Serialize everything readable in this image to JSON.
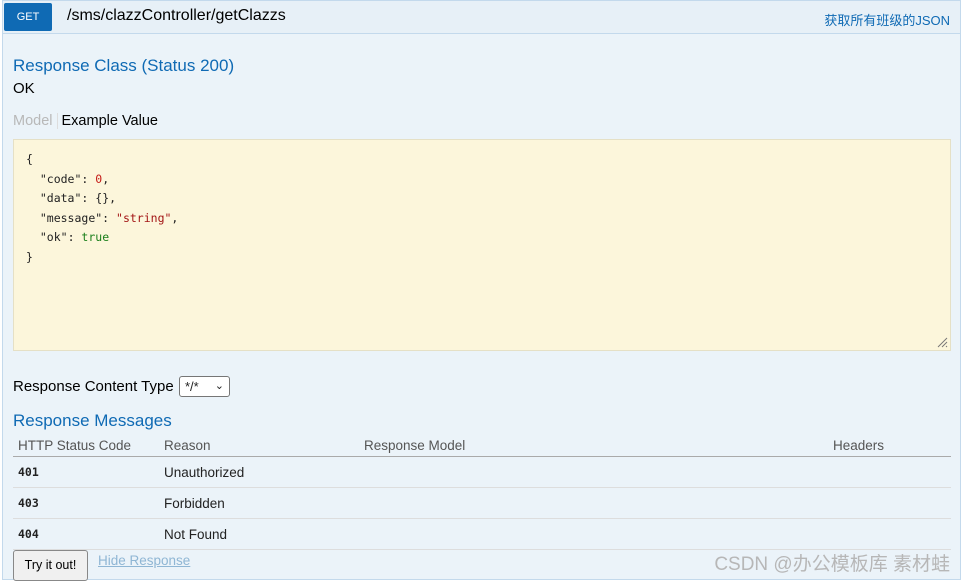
{
  "operation": {
    "method": "GET",
    "path": "/sms/clazzController/getClazzs",
    "summary": "获取所有班级的JSON"
  },
  "response_class": {
    "heading": "Response Class (Status 200)",
    "status_text": "OK",
    "tabs": {
      "model": "Model",
      "example": "Example Value"
    },
    "example_json": {
      "open": "{",
      "lines": [
        {
          "key": "\"code\"",
          "value": "0",
          "trail": ","
        },
        {
          "key": "\"data\"",
          "value": "{}",
          "trail": ","
        },
        {
          "key": "\"message\"",
          "value": "\"string\"",
          "trail": ","
        },
        {
          "key": "\"ok\"",
          "value": "true",
          "trail": ""
        }
      ],
      "close": "}"
    }
  },
  "response_content_type": {
    "label": "Response Content Type",
    "selected": "*/*"
  },
  "response_messages": {
    "heading": "Response Messages",
    "columns": [
      "HTTP Status Code",
      "Reason",
      "Response Model",
      "Headers"
    ],
    "rows": [
      {
        "code": "401",
        "reason": "Unauthorized",
        "model": "",
        "headers": ""
      },
      {
        "code": "403",
        "reason": "Forbidden",
        "model": "",
        "headers": ""
      },
      {
        "code": "404",
        "reason": "Not Found",
        "model": "",
        "headers": ""
      }
    ]
  },
  "actions": {
    "try_label": "Try it out!",
    "hide_label": "Hide Response"
  },
  "watermark": "CSDN @办公模板库 素材蛙"
}
